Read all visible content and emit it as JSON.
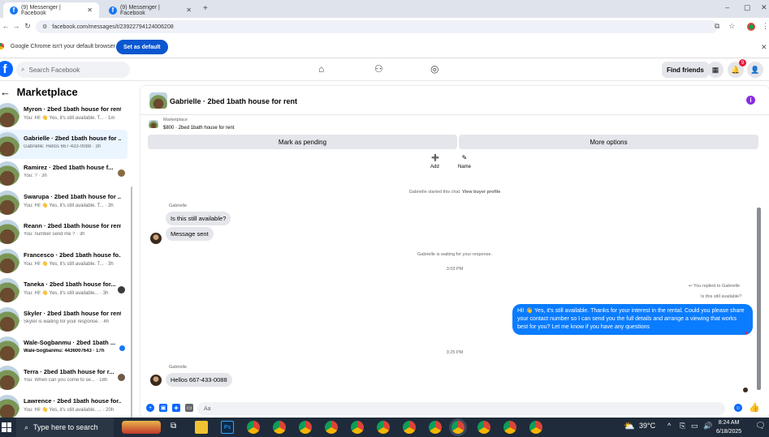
{
  "browser": {
    "tabs": [
      {
        "label": "(9) Messenger | Facebook"
      },
      {
        "label": "(9) Messenger | Facebook"
      }
    ],
    "url": "facebook.com/messages/t/23922794124006208",
    "infobar_text": "Google Chrome isn't your default browser",
    "set_default_label": "Set as default"
  },
  "fb": {
    "search_placeholder": "Search Facebook",
    "find_friends_label": "Find friends",
    "notif_count": "9"
  },
  "marketplace": {
    "title": "Marketplace",
    "conversations": [
      {
        "name": "Myron · 2bed 1bath house for rent",
        "snippet": "You: Hi! 👋 Yes, it's still available. T... · 1m"
      },
      {
        "name": "Gabrielle · 2bed 1bath house for ...",
        "snippet": "Gabrielle: Hellos 667-433-0088 · 3h"
      },
      {
        "name": "Ramirez · 2bed 1bath house f...",
        "snippet": "You: ? · 3h"
      },
      {
        "name": "Swarupa · 2bed 1bath house for ...",
        "snippet": "You: Hi! 👋 Yes, it's still available. T... · 3h"
      },
      {
        "name": "Reann · 2bed 1bath house for rent",
        "snippet": "You: number send me ? · 3h"
      },
      {
        "name": "Francesco · 2bed 1bath house fo...",
        "snippet": "You: Hi! 👋 Yes, it's still available. T... · 3h"
      },
      {
        "name": "Taneka · 2bed 1bath house for...",
        "snippet": "You: Hi! 👋 Yes, it's still available... · 3h"
      },
      {
        "name": "Skyler · 2bed 1bath house for rent",
        "snippet": "Skyler is waiting for your response. · 4h"
      },
      {
        "name": "Wale-Sogbanmu · 2bed 1bath ...",
        "snippet": "Wale-Sogbanmu: 4436007643 · 17h"
      },
      {
        "name": "Terra · 2bed 1bath house for r...",
        "snippet": "You: When can you come to se... · 18h"
      },
      {
        "name": "Lawrence · 2bed 1bath house for...",
        "snippet": "You: Hi! 👋 Yes, it's still available. ... · 20h"
      }
    ]
  },
  "chat": {
    "title": "Gabrielle · 2bed 1bath house for rent",
    "context_label": "Marketplace",
    "context_item": "$800 · 2bed 1bath house for rent",
    "mark_pending_label": "Mark as pending",
    "more_options_label": "More options",
    "add_label": "Add",
    "name_label": "Name",
    "started_text": "Gabrielle started this chat.",
    "view_profile_label": "View buyer profile",
    "sender1": "Gabrielle",
    "msg1": "Is this still available?",
    "msg2": "Message sent",
    "waiting_text": "Gabrielle is waiting for your response.",
    "time1": "3:03 PM",
    "replied_to": "You replied to Gabrielle",
    "quoted": "Is this still available?",
    "reply_text": "Hi! 👋 Yes, it's still available. Thanks for your interest in the rental. Could you please share your contact number so I can send you the full details and arrange a viewing that works best for you? Let me know if you have any questions",
    "time2": "3:25 PM",
    "sender2": "Gabrielle",
    "msg3": "Hellos 667-433-0088",
    "composer_placeholder": "Aa"
  },
  "taskbar": {
    "search_placeholder": "Type here to search",
    "temperature": "39°C",
    "time": "8:24 AM",
    "date": "6/18/2025"
  }
}
